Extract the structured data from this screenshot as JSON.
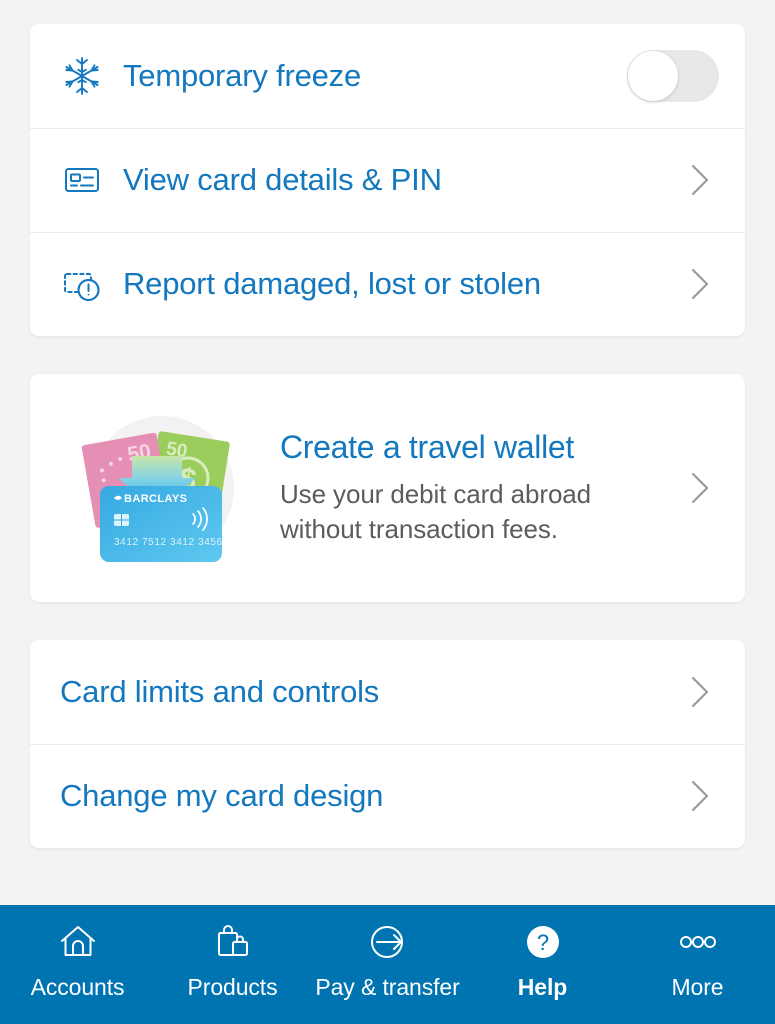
{
  "theme": {
    "page_bg": "#f4f3f2",
    "card_bg": "#ffffff",
    "link_blue": "#1478be",
    "nav_blue": "#0073b1",
    "body_gray": "#5c5c5c",
    "chevron_gray": "#9a9a9a",
    "toggle_track": "#e8e8e8"
  },
  "card_actions": {
    "rows": [
      {
        "label": "Temporary freeze",
        "icon": "snowflake-icon",
        "control": "toggle",
        "toggle_state": "off"
      },
      {
        "label": "View card details & PIN",
        "icon": "card-details-icon",
        "control": "chevron"
      },
      {
        "label": "Report damaged, lost or stolen",
        "icon": "damaged-card-icon",
        "control": "chevron"
      }
    ]
  },
  "promo": {
    "title": "Create a travel wallet",
    "subtitle": "Use your debit card abroad without transaction fees.",
    "control": "chevron",
    "artwork": {
      "name": "travel-wallet-illustration",
      "note_pink_value": "50",
      "note_green_value": "50",
      "currency_symbol": "$",
      "card_brand": "BARCLAYS",
      "card_number": "3412 7512 3412 3456"
    }
  },
  "card_settings": {
    "rows": [
      {
        "label": "Card limits and controls",
        "control": "chevron"
      },
      {
        "label": "Change my card design",
        "control": "chevron"
      }
    ]
  },
  "bottom_nav": {
    "items": [
      {
        "label": "Accounts",
        "icon": "home-icon",
        "active": false
      },
      {
        "label": "Products",
        "icon": "shopping-bags-icon",
        "active": false
      },
      {
        "label": "Pay & transfer",
        "icon": "arrow-circle-icon",
        "active": false
      },
      {
        "label": "Help",
        "icon": "question-circle-icon",
        "active": true
      },
      {
        "label": "More",
        "icon": "ellipsis-icon",
        "active": false
      }
    ]
  }
}
